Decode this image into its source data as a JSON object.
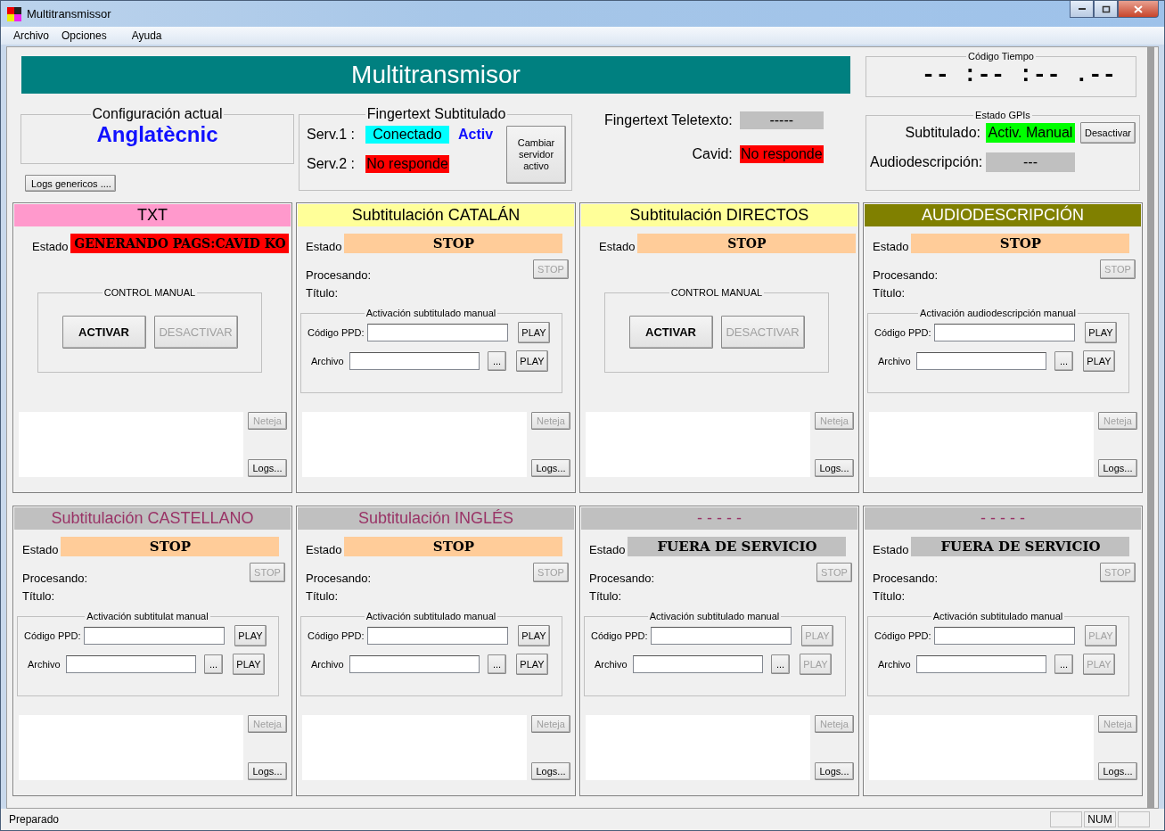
{
  "window": {
    "title": "Multitransmissor"
  },
  "menu": [
    {
      "label": "Archivo"
    },
    {
      "label": "Opciones"
    },
    {
      "label": "Ayuda"
    }
  ],
  "banner": "Multitransmisor",
  "config": {
    "legend": "Configuración actual",
    "value": "Anglatècnic",
    "logs_button": "Logs genericos ...."
  },
  "fingertext_sub": {
    "legend": "Fingertext Subtitulado",
    "servers": [
      {
        "label": "Serv.1 :",
        "status": "Conectado",
        "color": "#00ffff",
        "active_label": "Activ"
      },
      {
        "label": "Serv.2 :",
        "status": "No responde",
        "color": "#ff0000"
      }
    ],
    "switch_button": "Cambiar servidor activo"
  },
  "status_rows": [
    {
      "label": "Fingertext Teletexto:",
      "status": "-----",
      "color": "#c0c0c0"
    },
    {
      "label": "Cavid:",
      "status": "No responde",
      "color": "#ff0000"
    }
  ],
  "timecode": {
    "legend": "Código Tiempo",
    "value": "-- :-- :-- .--"
  },
  "gpis": {
    "legend": "Estado GPIs",
    "rows": [
      {
        "label": "Subtitulado:",
        "status": "Activ. Manual",
        "color": "#00ff00",
        "button": "Desactivar"
      },
      {
        "label": "Audiodescripción:",
        "status": "---",
        "color": "#c0c0c0"
      }
    ]
  },
  "panels": [
    {
      "kind": "control",
      "header": {
        "title": {
          "text": "TXT",
          "color": "#000000"
        },
        "color": "#ff99cc"
      },
      "estado_label": "Estado",
      "estado": {
        "text": "GENERANDO PAGS:CAVID KO",
        "color": "#ff0000"
      },
      "group": "CONTROL MANUAL",
      "buttons": [
        {
          "label": "ACTIVAR",
          "disabled": false
        },
        {
          "label": "DESACTIVAR",
          "disabled": true
        }
      ],
      "neteja": {
        "label": "Neteja",
        "disabled": true
      },
      "logs": "Logs..."
    },
    {
      "kind": "channel",
      "header": {
        "title": {
          "text": "Subtitulación CATALÁN",
          "color": "#000000"
        },
        "color": "#ffff99"
      },
      "estado_label": "Estado",
      "estado": {
        "text": "STOP",
        "color": "#ffcc99"
      },
      "procesando": "Procesando:",
      "titulo": "Título:",
      "stop": {
        "label": "STOP",
        "disabled": true
      },
      "group": "Activación subtitulado manual",
      "ppd_label": "Código PPD:",
      "archivo_label": "Archivo",
      "browse": "...",
      "play": [
        {
          "label": "PLAY",
          "disabled": false
        },
        {
          "label": "PLAY",
          "disabled": false
        }
      ],
      "neteja": {
        "label": "Neteja",
        "disabled": true
      },
      "logs": "Logs..."
    },
    {
      "kind": "control",
      "header": {
        "title": {
          "text": "Subtitulación DIRECTOS",
          "color": "#000000"
        },
        "color": "#ffff99"
      },
      "estado_label": "Estado",
      "estado": {
        "text": "STOP",
        "color": "#ffcc99"
      },
      "group": "CONTROL MANUAL",
      "buttons": [
        {
          "label": "ACTIVAR",
          "disabled": false
        },
        {
          "label": "DESACTIVAR",
          "disabled": true
        }
      ],
      "neteja": {
        "label": "Neteja",
        "disabled": true
      },
      "logs": "Logs..."
    },
    {
      "kind": "channel",
      "header": {
        "title": {
          "text": "AUDIODESCRIPCIÓN",
          "color": "#ffffff"
        },
        "color": "#808000"
      },
      "estado_label": "Estado",
      "estado": {
        "text": "STOP",
        "color": "#ffcc99"
      },
      "procesando": "Procesando:",
      "titulo": "Título:",
      "stop": {
        "label": "STOP",
        "disabled": true
      },
      "group": "Activación audiodescripción manual",
      "ppd_label": "Código PPD:",
      "archivo_label": "Archivo",
      "browse": "...",
      "play": [
        {
          "label": "PLAY",
          "disabled": false
        },
        {
          "label": "PLAY",
          "disabled": false
        }
      ],
      "neteja": {
        "label": "Neteja",
        "disabled": true
      },
      "logs": "Logs..."
    },
    {
      "kind": "channel",
      "header": {
        "title": {
          "text": "Subtitulación CASTELLANO",
          "color": "#993366"
        },
        "color": "#c0c0c0"
      },
      "estado_label": "Estado",
      "estado": {
        "text": "STOP",
        "color": "#ffcc99"
      },
      "procesando": "Procesando:",
      "titulo": "Título:",
      "stop": {
        "label": "STOP",
        "disabled": true
      },
      "group": "Activación subtitulat manual",
      "ppd_label": "Código PPD:",
      "archivo_label": "Archivo",
      "browse": "...",
      "play": [
        {
          "label": "PLAY",
          "disabled": false
        },
        {
          "label": "PLAY",
          "disabled": false
        }
      ],
      "neteja": {
        "label": "Neteja",
        "disabled": true
      },
      "logs": "Logs..."
    },
    {
      "kind": "channel",
      "header": {
        "title": {
          "text": "Subtitulación INGLÉS",
          "color": "#993366"
        },
        "color": "#c0c0c0"
      },
      "estado_label": "Estado",
      "estado": {
        "text": "STOP",
        "color": "#ffcc99"
      },
      "procesando": "Procesando:",
      "titulo": "Título:",
      "stop": {
        "label": "STOP",
        "disabled": true
      },
      "group": "Activación subtitulado manual",
      "ppd_label": "Código PPD:",
      "archivo_label": "Archivo",
      "browse": "...",
      "play": [
        {
          "label": "PLAY",
          "disabled": false
        },
        {
          "label": "PLAY",
          "disabled": false
        }
      ],
      "neteja": {
        "label": "Neteja",
        "disabled": true
      },
      "logs": "Logs..."
    },
    {
      "kind": "channel",
      "header": {
        "title": {
          "text": "- - - - -",
          "color": "#993366"
        },
        "color": "#c0c0c0"
      },
      "estado_label": "Estado",
      "estado": {
        "text": "FUERA DE SERVICIO",
        "color": "#c0c0c0"
      },
      "procesando": "Procesando:",
      "titulo": "Título:",
      "stop": {
        "label": "STOP",
        "disabled": true
      },
      "group": "Activación subtitulado manual",
      "ppd_label": "Código PPD:",
      "archivo_label": "Archivo",
      "browse": "...",
      "play": [
        {
          "label": "PLAY",
          "disabled": true
        },
        {
          "label": "PLAY",
          "disabled": true
        }
      ],
      "neteja": {
        "label": "Neteja",
        "disabled": true
      },
      "logs": "Logs..."
    },
    {
      "kind": "channel",
      "header": {
        "title": {
          "text": "- - - - -",
          "color": "#993366"
        },
        "color": "#c0c0c0"
      },
      "estado_label": "Estado",
      "estado": {
        "text": "FUERA DE SERVICIO",
        "color": "#c0c0c0"
      },
      "procesando": "Procesando:",
      "titulo": "Título:",
      "stop": {
        "label": "STOP",
        "disabled": true
      },
      "group": "Activación subtitulado manual",
      "ppd_label": "Código PPD:",
      "archivo_label": "Archivo",
      "browse": "...",
      "play": [
        {
          "label": "PLAY",
          "disabled": true
        },
        {
          "label": "PLAY",
          "disabled": true
        }
      ],
      "neteja": {
        "label": "Neteja",
        "disabled": true
      },
      "logs": "Logs..."
    }
  ],
  "status_bar": {
    "text": "Preparado",
    "indicators": [
      {
        "label": "NUM"
      }
    ]
  }
}
